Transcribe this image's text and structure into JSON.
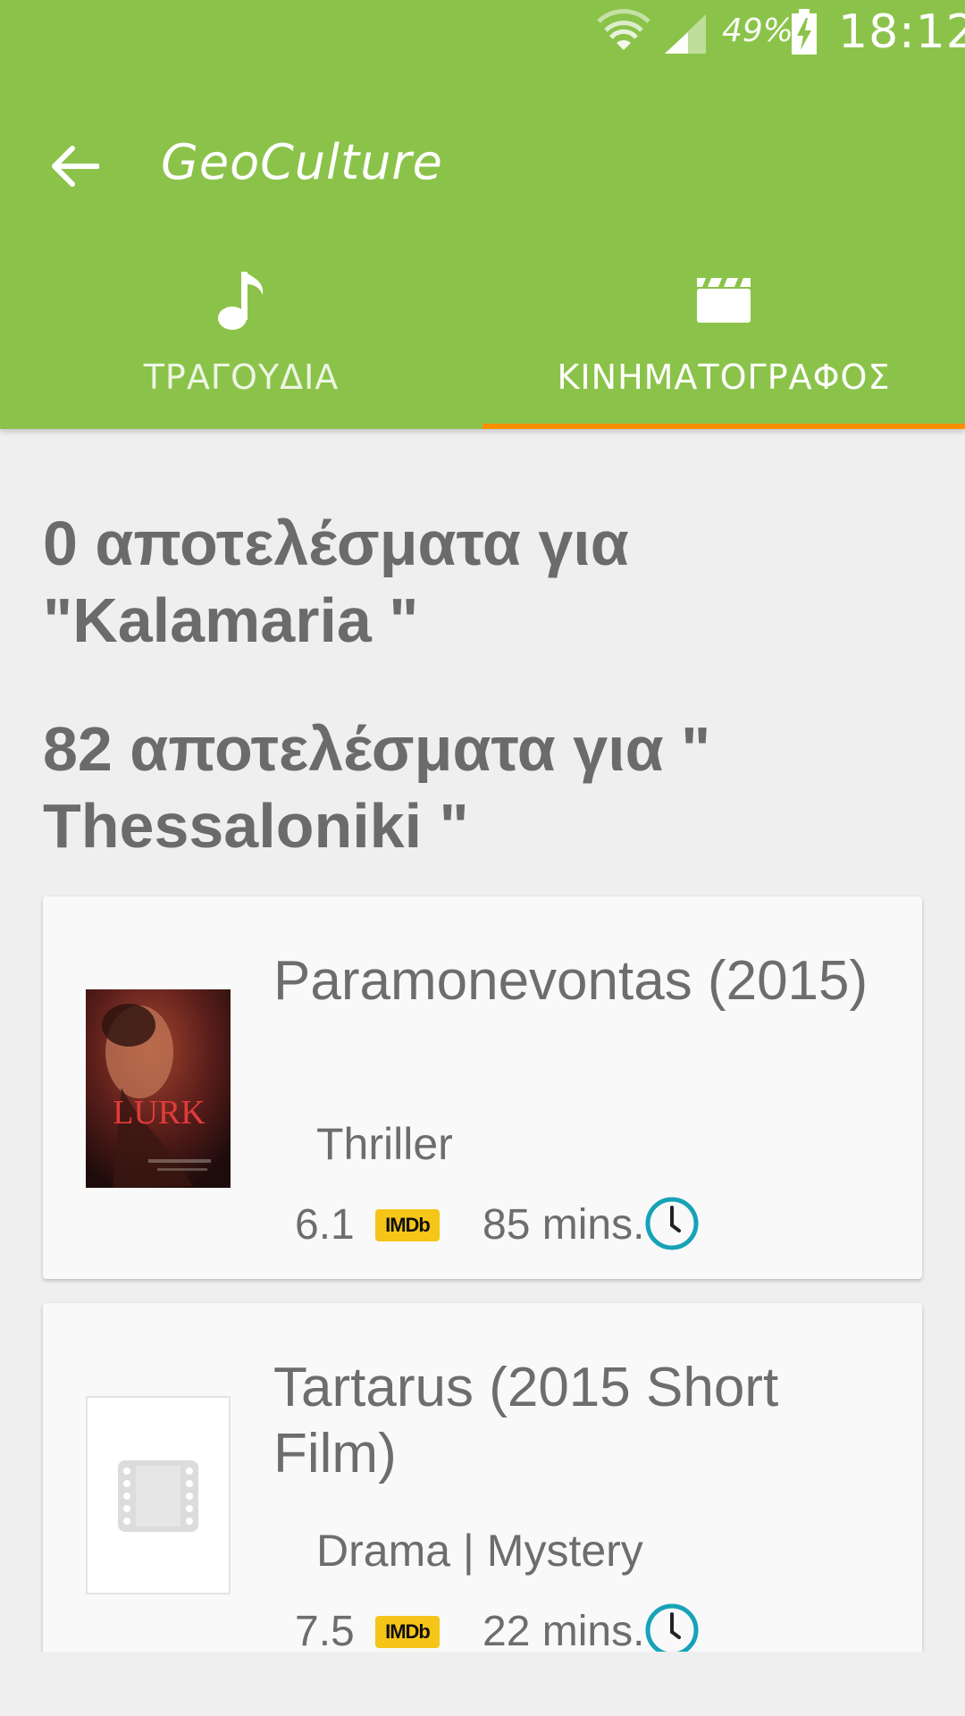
{
  "status_bar": {
    "battery": "49%",
    "time": "18:12"
  },
  "toolbar": {
    "title": "GeoCulture",
    "back_icon": "arrow-back-icon"
  },
  "tabs": [
    {
      "label": "ΤΡΑΓΟΥΔΙΑ",
      "icon": "music-note-icon",
      "selected": false
    },
    {
      "label": "ΚΙΝΗΜΑΤΟΓΡΑΦΟΣ",
      "icon": "movie-clapper-icon",
      "selected": true
    }
  ],
  "results": {
    "heading_1": "0 αποτελέσματα για \"Kalamaria \"",
    "heading_2": "82 αποτελέσματα για \" Thessaloniki \""
  },
  "movies": [
    {
      "title": "Paramonevontas (2015)",
      "genre": "Thriller",
      "rating": "6.1",
      "imdb_label": "IMDb",
      "duration": "85 mins.",
      "poster_text": "LURK"
    },
    {
      "title": "Tartarus (2015 Short Film)",
      "genre": "Drama | Mystery",
      "rating": "7.5",
      "imdb_label": "IMDb",
      "duration": "22 mins."
    }
  ],
  "colors": {
    "primary": "#8bc34a",
    "accent": "#ff8f00",
    "imdb": "#f5c518",
    "clock": "#17a2b8"
  }
}
